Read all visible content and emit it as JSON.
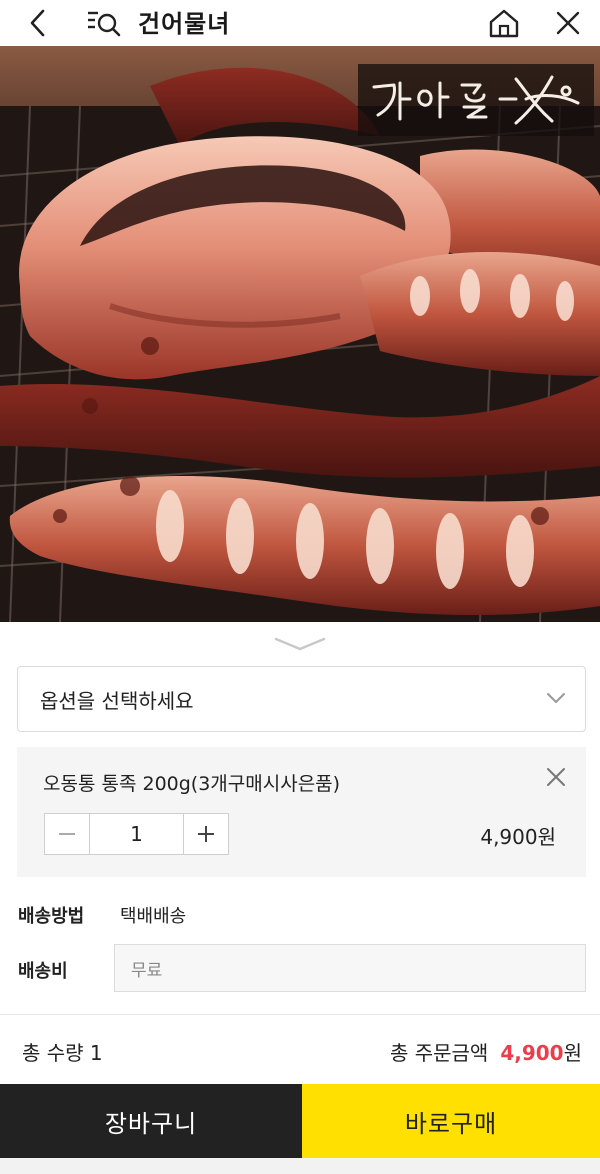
{
  "header": {
    "title": "건어물녀",
    "back_icon": "chevron-left-icon",
    "category_search_icon": "category-search-icon",
    "home_icon": "home-icon",
    "close_icon": "close-icon"
  },
  "product_image": {
    "alt": "",
    "logo_text": "건어물녀"
  },
  "option": {
    "placeholder": "옵션을 선택하세요"
  },
  "selected_item": {
    "name": "오동통 통족 200g(3개구매시사은품)",
    "quantity": "1",
    "minus": "−",
    "plus": "+",
    "price": "4,900원"
  },
  "shipping": {
    "method_label": "배송방법",
    "method_value": "택배배송",
    "fee_label": "배송비",
    "fee_value": "무료"
  },
  "totals": {
    "qty_text": "총 수량 1",
    "amount_label": "총 주문금액",
    "amount_value": "4,900",
    "amount_unit": "원"
  },
  "buttons": {
    "cart": "장바구니",
    "buy": "바로구매"
  },
  "colors": {
    "accent_yellow": "#ffe000",
    "dark": "#222222",
    "price_red": "#ee3d4a"
  }
}
